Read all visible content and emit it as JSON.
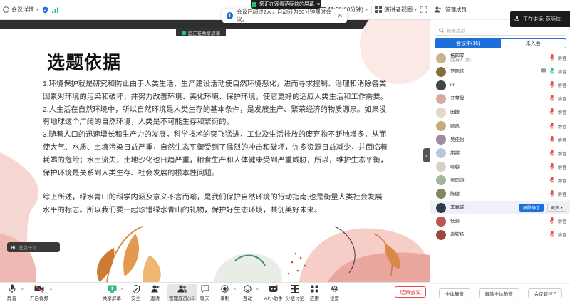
{
  "top_bar": {
    "meeting_info_label": "会议详情",
    "timer": "11:36(60分钟)",
    "view_label": "演讲者视图",
    "viewing_pill": "您正在观看范际炫的屏幕"
  },
  "share": {
    "status_label": "您正在共享屏幕",
    "toast_text": "会议已超过2人，自动转为60分钟限时会议。",
    "chat_placeholder": "说点什么..."
  },
  "slide": {
    "title": "选题依据",
    "paragraphs": [
      "1.环境保护就是研究和防止由于人类生活、生产建设活动使自然环境恶化，进而寻求控制、治理和消除各类因素对环境的污染和破坏，并努力改善环境、美化环境、保护环境，使它更好的适应人类生活和工作需要。",
      "2.人生活在自然环境中，所以自然环境是人类生存的基本条件，是发展生产、繁荣经济的物质源泉。如果没有地球这个广阔的自然环境，人类是不可能生存和繁衍的。",
      "3.随着人口的迅速增长和生产力的发展，科学技术的突飞猛进，工业及生活排放的废弃物不断地增多，从而使大气、水质、土壤污染日益严重，自然生态平衡受到了猛烈的冲击和破坏，许多资源日益减少，并面临着耗竭的危险；水土流失，土地沙化也日趋严重，粮食生产和人体健康受到严重威胁，所以，维护生态平衡，保护环境是关系到人类生存、社会发展的根本性问题。",
      "综上所述，绿水青山的科学内涵及意义不言而喻，是我们保护自然环境的行动指南,也是衡量人类社会发展水平的标志。所以我们要一起珍惜绿水青山的礼物，保护好生态环境，共创美好未来。"
    ]
  },
  "toolbar": {
    "mute": "静音",
    "video": "开启视频",
    "share": "共享屏幕",
    "security": "安全",
    "invite": "邀请",
    "participants": "管理成员(16)",
    "chat": "聊天",
    "record": "录制",
    "react": "互动",
    "ai": "AI小助手",
    "breakout": "分组讨论",
    "apps": "应用",
    "settings": "设置",
    "leave": "结束会议"
  },
  "panel": {
    "title": "管理成员",
    "speaking": "正在讲话: 范际炫;",
    "search_placeholder": "搜索成员",
    "tab_in_meeting": "会议中(16)",
    "tab_not_joined": "未入会",
    "participants": [
      {
        "name": "杨四零",
        "sub": "(主持人, 我)",
        "color": "#c7b38e"
      },
      {
        "name": "范际炫",
        "sub": "",
        "color": "#8a6b3e"
      },
      {
        "name": "nn",
        "sub": "",
        "color": "#444"
      },
      {
        "name": "江梦馨",
        "sub": "",
        "color": "#d9a9a0"
      },
      {
        "name": "田捷",
        "sub": "",
        "color": "#e3d8c7"
      },
      {
        "name": "顾凯",
        "sub": "",
        "color": "#c9a97a"
      },
      {
        "name": "吴佳怡",
        "sub": "",
        "color": "#9d8c9e"
      },
      {
        "name": "甜甜",
        "sub": "",
        "color": "#b8c7d9"
      },
      {
        "name": "喻蓉",
        "sub": "",
        "color": "#d7d0c3"
      },
      {
        "name": "张雨涛",
        "sub": "",
        "color": "#a5b59a"
      },
      {
        "name": "陈健",
        "sub": "",
        "color": "#7e8a5c"
      },
      {
        "name": "李嘉诚",
        "sub": "",
        "color": "#2d3b4d"
      },
      {
        "name": "任豪",
        "sub": "",
        "color": "#b55"
      },
      {
        "name": "袁钦扬",
        "sub": "",
        "color": "#9a4a3c"
      }
    ],
    "row_mute_label": "静音",
    "unmute_button": "解除静音",
    "more_button": "更多",
    "mute_all": "全体静音",
    "unmute_all": "解除全体静音",
    "manage_meeting": "会议管控"
  },
  "colors": {
    "accent": "#1e6fd9",
    "danger": "#e24a4a",
    "green": "#22c56b"
  }
}
